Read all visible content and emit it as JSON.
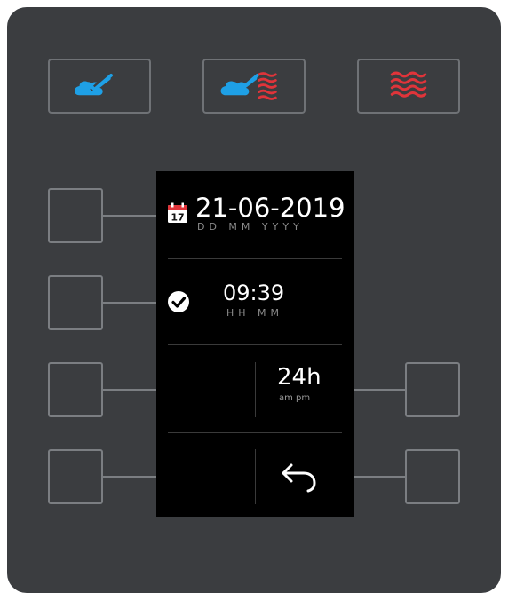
{
  "modes": [
    {
      "name": "steam",
      "icon": "steam-icon"
    },
    {
      "name": "combi",
      "icon": "combi-steam-heat-icon"
    },
    {
      "name": "hot-air",
      "icon": "hot-air-waves-icon"
    }
  ],
  "colors": {
    "steam_blue": "#1ea0e6",
    "heat_red": "#e0343a",
    "panel": "#3b3d40",
    "button_border": "#7b7e82"
  },
  "date": {
    "value": "21-06-2019",
    "format": "DD MM YYYY",
    "icon": "calendar-icon",
    "calendar_day": "17"
  },
  "time": {
    "value": "09:39",
    "format": "HH MM",
    "icon": "check-circle-icon"
  },
  "clock_format": {
    "value": "24h",
    "alt_label": "am pm"
  },
  "back": {
    "icon": "back-arrow-icon"
  }
}
